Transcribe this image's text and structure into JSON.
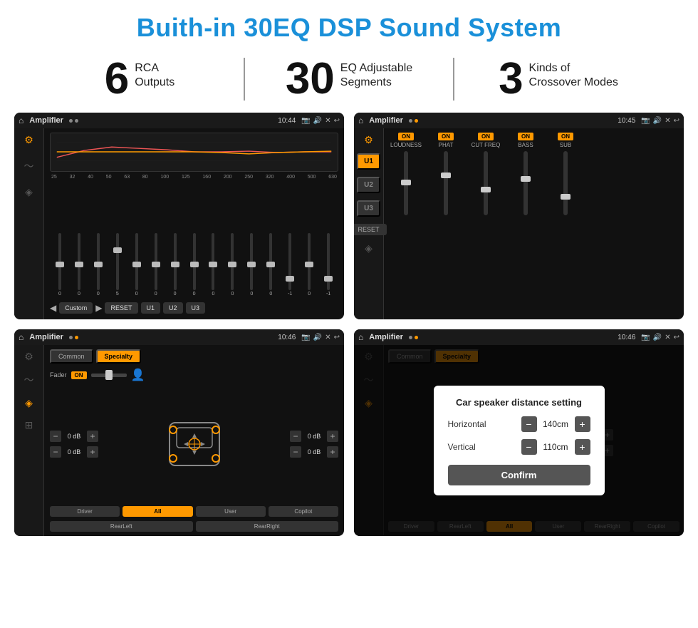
{
  "page": {
    "title": "Buith-in 30EQ DSP Sound System"
  },
  "stats": [
    {
      "number": "6",
      "label": "RCA\nOutputs"
    },
    {
      "number": "30",
      "label": "EQ Adjustable\nSegments"
    },
    {
      "number": "3",
      "label": "Kinds of\nCrossover Modes"
    }
  ],
  "screens": {
    "screen1": {
      "topbar": {
        "title": "Amplifier",
        "time": "10:44"
      },
      "eq_freqs": [
        "25",
        "32",
        "40",
        "50",
        "63",
        "80",
        "100",
        "125",
        "160",
        "200",
        "250",
        "320",
        "400",
        "500",
        "630"
      ],
      "eq_values": [
        "0",
        "0",
        "0",
        "5",
        "0",
        "0",
        "0",
        "0",
        "0",
        "0",
        "0",
        "0",
        "-1",
        "0",
        "-1"
      ],
      "buttons": [
        "Custom",
        "RESET",
        "U1",
        "U2",
        "U3"
      ]
    },
    "screen2": {
      "topbar": {
        "title": "Amplifier",
        "time": "10:45"
      },
      "u_buttons": [
        "U1",
        "U2",
        "U3"
      ],
      "controls": [
        "LOUDNESS",
        "PHAT",
        "CUT FREQ",
        "BASS",
        "SUB"
      ],
      "reset_label": "RESET"
    },
    "screen3": {
      "topbar": {
        "title": "Amplifier",
        "time": "10:46"
      },
      "tabs": [
        "Common",
        "Specialty"
      ],
      "fader_label": "Fader",
      "fader_status": "ON",
      "vol_rows": [
        {
          "val": "0 dB"
        },
        {
          "val": "0 dB"
        },
        {
          "val": "0 dB"
        },
        {
          "val": "0 dB"
        }
      ],
      "bottom_buttons": [
        "Driver",
        "RearLeft",
        "All",
        "User",
        "RearRight",
        "Copilot"
      ]
    },
    "screen4": {
      "topbar": {
        "title": "Amplifier",
        "time": "10:46"
      },
      "tabs": [
        "Common",
        "Specialty"
      ],
      "dialog": {
        "title": "Car speaker distance setting",
        "horizontal_label": "Horizontal",
        "horizontal_value": "140cm",
        "vertical_label": "Vertical",
        "vertical_value": "110cm",
        "confirm_label": "Confirm"
      },
      "bottom_buttons": [
        "Driver",
        "RearLeft",
        "All",
        "User",
        "RearRight",
        "Copilot"
      ]
    }
  }
}
